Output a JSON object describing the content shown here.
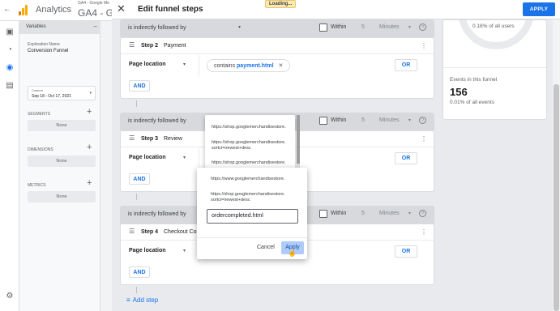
{
  "app": {
    "name": "Analytics",
    "account": "GA4 - Google Me",
    "property": "GA4 - Go"
  },
  "variables_panel": {
    "header": "Variables",
    "exploration_label": "Exploration Name",
    "exploration_name": "Conversion Funnel",
    "date_label": "Custom",
    "date_value": "Sep 18 - Oct 17, 2021",
    "sections": [
      {
        "title": "SEGMENTS",
        "none": "None"
      },
      {
        "title": "DIMENSIONS",
        "none": "None"
      },
      {
        "title": "METRICS",
        "none": "None"
      }
    ]
  },
  "dialog": {
    "title": "Edit funnel steps",
    "loading": "Loading...",
    "apply": "APPLY"
  },
  "within": {
    "label": "Within",
    "number": "5",
    "unit": "Minutes"
  },
  "follow_bars": [
    {
      "text": "is indirectly followed by"
    },
    {
      "text": "is indirectly followed by"
    },
    {
      "text": "is indirectly followed by"
    }
  ],
  "steps": [
    {
      "number": "Step 2",
      "name": "Payment",
      "field": "Page location",
      "operator": "contains",
      "value": "payment.html",
      "or": "OR",
      "and": "AND"
    },
    {
      "number": "Step 3",
      "name": "Review",
      "field": "Page location",
      "or": "OR",
      "and": "AND"
    },
    {
      "number": "Step 4",
      "name": "Checkout Com",
      "field": "Page location",
      "or": "OR",
      "and": "AND"
    }
  ],
  "add_step": "Add step",
  "summary": {
    "percent_users": "0.18% of all users",
    "events_label": "Events in this funnel",
    "events_value": "156",
    "events_percent": "0.01% of all events"
  },
  "suggestions": [
    "https://shop.googlemerchandisestore.",
    "https://shop.googlemerchandisestore.",
    "sortci=newest+desc",
    "https://shop.googlemerchandisestore.",
    "https://www.googlemerchandisestore.",
    "https://shop.googlemerchandisestore.",
    "sortci=newest+desc"
  ],
  "value_editor": {
    "value": "ordercompleted.html",
    "cancel": "Cancel",
    "apply": "Apply"
  }
}
